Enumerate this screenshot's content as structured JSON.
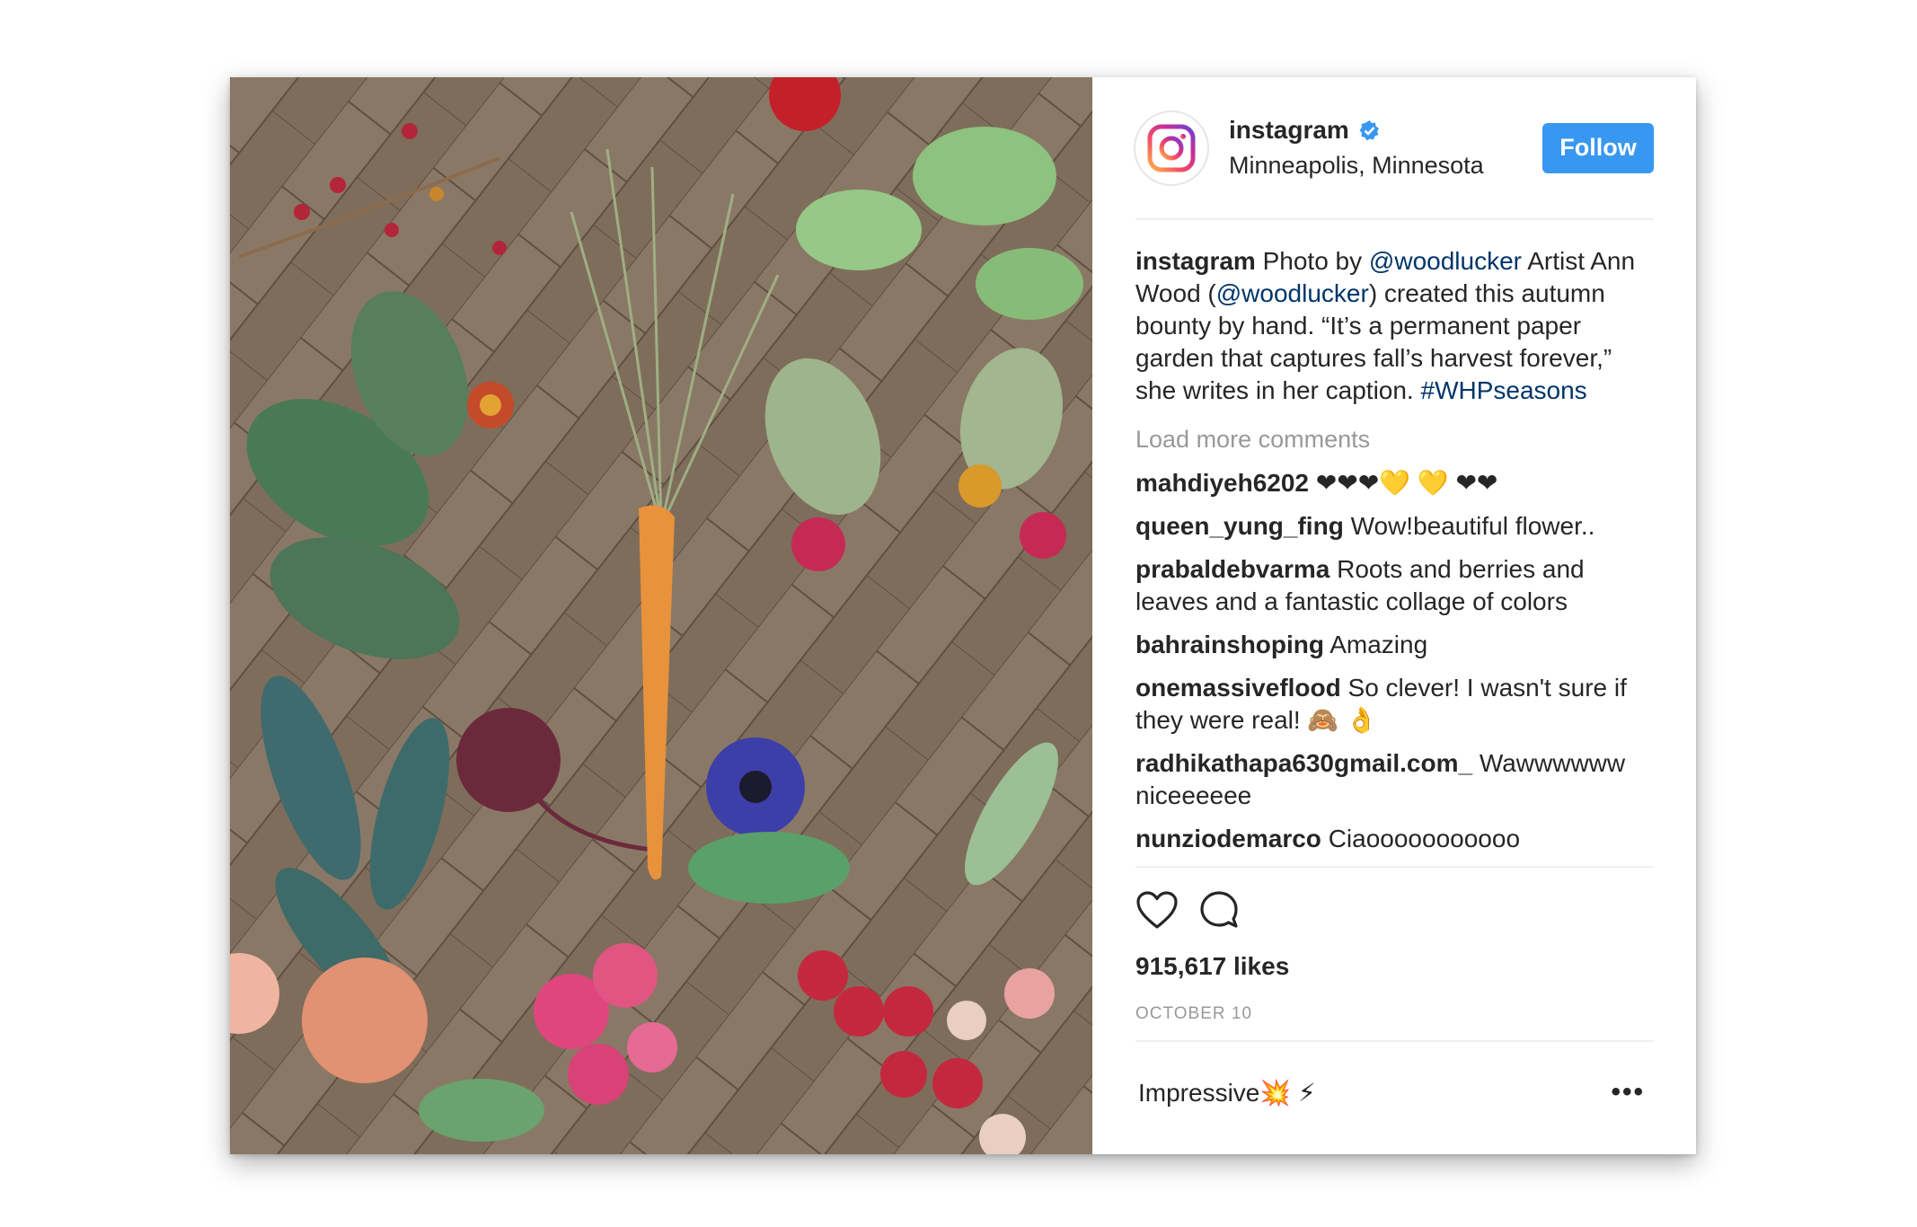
{
  "header": {
    "username": "instagram",
    "location": "Minneapolis, Minnesota",
    "follow_label": "Follow"
  },
  "caption": {
    "username": "instagram",
    "text_1": " Photo by ",
    "mention_1": "@woodlucker",
    "text_2": " Artist Ann Wood (",
    "mention_2": "@woodlucker",
    "text_3": ") created this autumn bounty by hand. “It’s a permanent paper garden that captures fall’s harvest forever,” she writes in her caption. ",
    "hashtag": "#WHPseasons"
  },
  "load_more_label": "Load more comments",
  "comments": [
    {
      "user": "mahdiyeh6202",
      "text": " ❤❤❤💛 💛 ❤❤"
    },
    {
      "user": "queen_yung_fing",
      "text": " Wow!beautiful flower.."
    },
    {
      "user": "prabaldebvarma",
      "text": " Roots and berries and leaves and a fantastic collage of colors"
    },
    {
      "user": "bahrainshoping",
      "text": " Amazing"
    },
    {
      "user": "onemassiveflood",
      "text": " So clever! I wasn't sure if they were real! 🙈 👌"
    },
    {
      "user": "radhikathapa630gmail.com_",
      "text": " Wawwwwww niceeeeee"
    },
    {
      "user": "nunziodemarco",
      "text": " Ciaooooooooooo"
    }
  ],
  "icons": {
    "like": "heart-icon",
    "comment": "comment-bubble-icon",
    "verified": "verified-badge-icon",
    "more": "more-options-icon"
  },
  "likes_label": "915,617 likes",
  "date_label": "OCTOBER 10",
  "comment_input": {
    "value": "Impressive💥 ⚡",
    "more_label": "•••"
  },
  "colors": {
    "follow_button": "#3897f0",
    "mention": "#003569",
    "muted_text": "#999999"
  }
}
